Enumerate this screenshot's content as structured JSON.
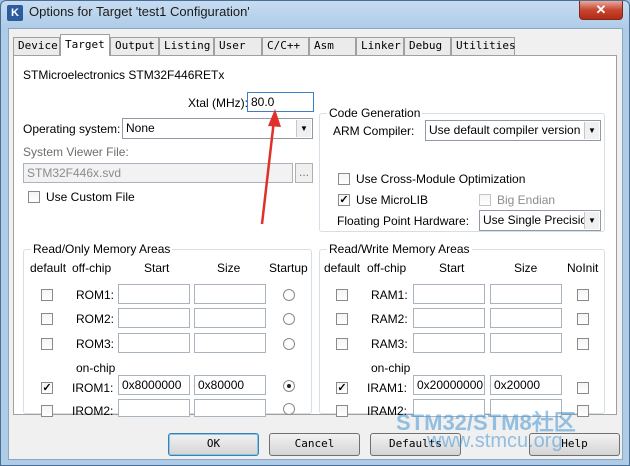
{
  "window": {
    "title": "Options for Target 'test1 Configuration'",
    "close": "✕"
  },
  "tabs": [
    "Device",
    "Target",
    "Output",
    "Listing",
    "User",
    "C/C++",
    "Asm",
    "Linker",
    "Debug",
    "Utilities"
  ],
  "active_tab": "Target",
  "device_name": "STMicroelectronics STM32F446RETx",
  "xtal": {
    "label": "Xtal (MHz):",
    "value": "80.0"
  },
  "operating_system": {
    "label": "Operating system:",
    "value": "None"
  },
  "system_viewer": {
    "label": "System Viewer File:",
    "value": "STM32F446x.svd",
    "browse": "..."
  },
  "use_custom_file": {
    "label": "Use Custom File",
    "checked": false
  },
  "code_generation": {
    "title": "Code Generation",
    "arm_compiler_label": "ARM Compiler:",
    "arm_compiler_value": "Use default compiler version",
    "cross_module": {
      "label": "Use Cross-Module Optimization",
      "checked": false
    },
    "microlib": {
      "label": "Use MicroLIB",
      "checked": true
    },
    "big_endian": {
      "label": "Big Endian",
      "checked": false,
      "disabled": true
    },
    "fph_label": "Floating Point Hardware:",
    "fph_value": "Use Single Precision"
  },
  "ro_memory": {
    "title": "Read/Only Memory Areas",
    "headers": {
      "default": "default",
      "offchip": "off-chip",
      "start": "Start",
      "size": "Size",
      "startup": "Startup"
    },
    "onchip_label": "on-chip",
    "rows": [
      {
        "name": "ROM1:",
        "start": "",
        "size": "",
        "default": false,
        "startup": false
      },
      {
        "name": "ROM2:",
        "start": "",
        "size": "",
        "default": false,
        "startup": false
      },
      {
        "name": "ROM3:",
        "start": "",
        "size": "",
        "default": false,
        "startup": false
      },
      {
        "name": "IROM1:",
        "start": "0x8000000",
        "size": "0x80000",
        "default": true,
        "startup": true
      },
      {
        "name": "IROM2:",
        "start": "",
        "size": "",
        "default": false,
        "startup": false
      }
    ]
  },
  "rw_memory": {
    "title": "Read/Write Memory Areas",
    "headers": {
      "default": "default",
      "offchip": "off-chip",
      "start": "Start",
      "size": "Size",
      "noinit": "NoInit"
    },
    "onchip_label": "on-chip",
    "rows": [
      {
        "name": "RAM1:",
        "start": "",
        "size": "",
        "default": false,
        "noinit": false
      },
      {
        "name": "RAM2:",
        "start": "",
        "size": "",
        "default": false,
        "noinit": false
      },
      {
        "name": "RAM3:",
        "start": "",
        "size": "",
        "default": false,
        "noinit": false
      },
      {
        "name": "IRAM1:",
        "start": "0x20000000",
        "size": "0x20000",
        "default": true,
        "noinit": false
      },
      {
        "name": "IRAM2:",
        "start": "",
        "size": "",
        "default": false,
        "noinit": false
      }
    ]
  },
  "buttons": {
    "ok": "OK",
    "cancel": "Cancel",
    "defaults": "Defaults",
    "help": "Help"
  },
  "watermark": {
    "line1": "STM32/STM8社区",
    "line2": "www.stmcu.org"
  },
  "colors": {
    "annotation_arrow": "#e0302a",
    "watermark": "#4696d2"
  }
}
